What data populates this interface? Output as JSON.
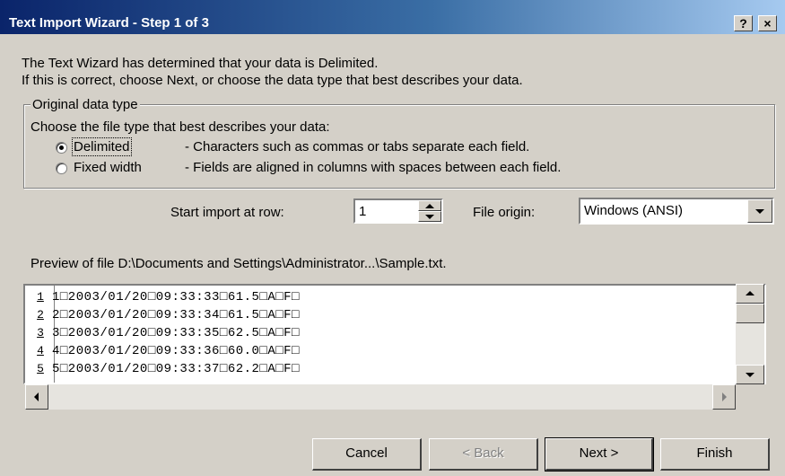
{
  "window": {
    "title": "Text Import Wizard - Step 1 of 3",
    "help_label": "?",
    "close_label": "×"
  },
  "intro": {
    "line1": "The Text Wizard has determined that your data is Delimited.",
    "line2": "If this is correct, choose Next, or choose the data type that best describes your data."
  },
  "data_type": {
    "group_label": "Original data type",
    "prompt": "Choose the file type that best describes your data:",
    "options": [
      {
        "label": "Delimited",
        "description": "- Characters such as commas or tabs separate each field.",
        "selected": true
      },
      {
        "label": "Fixed width",
        "description": "- Fields are aligned in columns with spaces between each field.",
        "selected": false
      }
    ]
  },
  "start_row": {
    "label": "Start import at row:",
    "value": "1"
  },
  "file_origin": {
    "label": "File origin:",
    "value": "Windows (ANSI)"
  },
  "preview": {
    "label": "Preview of file D:\\Documents and Settings\\Administrator...\\Sample.txt.",
    "rows": [
      {
        "num": "1",
        "text": "1□2003/01/20□09:33:33□61.5□A□F□"
      },
      {
        "num": "2",
        "text": "2□2003/01/20□09:33:34□61.5□A□F□"
      },
      {
        "num": "3",
        "text": "3□2003/01/20□09:33:35□62.5□A□F□"
      },
      {
        "num": "4",
        "text": "4□2003/01/20□09:33:36□60.0□A□F□"
      },
      {
        "num": "5",
        "text": "5□2003/01/20□09:33:37□62.2□A□F□"
      }
    ]
  },
  "buttons": {
    "cancel": "Cancel",
    "back": "< Back",
    "next": "Next >",
    "finish": "Finish"
  },
  "icons": {
    "help": "help-icon",
    "close": "close-icon",
    "spin_up": "chevron-up-icon",
    "spin_down": "chevron-down-icon",
    "dropdown": "chevron-down-icon"
  },
  "colors": {
    "title_bar_start": "#0a246a",
    "title_bar_end": "#a6caf0",
    "dialog_bg": "#d4d0c8"
  }
}
